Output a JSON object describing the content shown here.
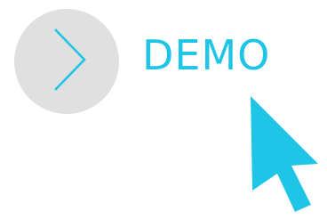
{
  "demo": {
    "label": "DEMO",
    "icon": "chevron-right-icon"
  },
  "cursor": {
    "icon": "mouse-pointer-icon"
  },
  "colors": {
    "accent": "#1ec5e6",
    "circle": "#e0e0e0",
    "background": "#ffffff"
  }
}
